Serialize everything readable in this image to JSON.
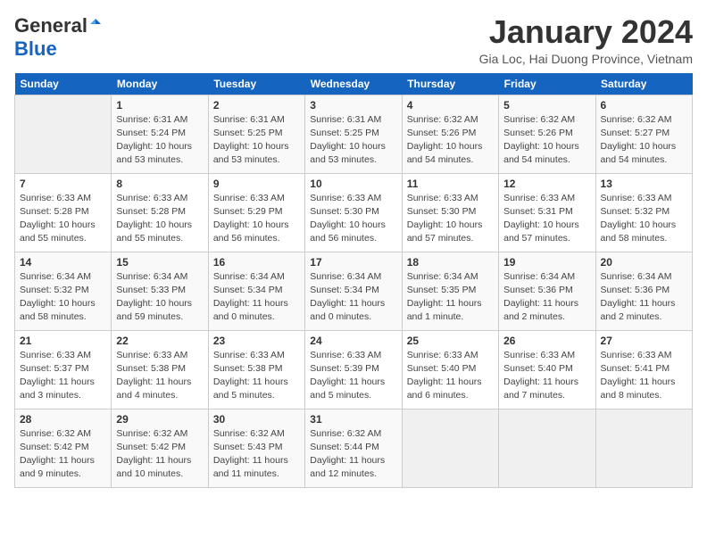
{
  "header": {
    "logo_general": "General",
    "logo_blue": "Blue",
    "month_title": "January 2024",
    "location": "Gia Loc, Hai Duong Province, Vietnam"
  },
  "days_of_week": [
    "Sunday",
    "Monday",
    "Tuesday",
    "Wednesday",
    "Thursday",
    "Friday",
    "Saturday"
  ],
  "weeks": [
    [
      {
        "day": "",
        "info": ""
      },
      {
        "day": "1",
        "info": "Sunrise: 6:31 AM\nSunset: 5:24 PM\nDaylight: 10 hours\nand 53 minutes."
      },
      {
        "day": "2",
        "info": "Sunrise: 6:31 AM\nSunset: 5:25 PM\nDaylight: 10 hours\nand 53 minutes."
      },
      {
        "day": "3",
        "info": "Sunrise: 6:31 AM\nSunset: 5:25 PM\nDaylight: 10 hours\nand 53 minutes."
      },
      {
        "day": "4",
        "info": "Sunrise: 6:32 AM\nSunset: 5:26 PM\nDaylight: 10 hours\nand 54 minutes."
      },
      {
        "day": "5",
        "info": "Sunrise: 6:32 AM\nSunset: 5:26 PM\nDaylight: 10 hours\nand 54 minutes."
      },
      {
        "day": "6",
        "info": "Sunrise: 6:32 AM\nSunset: 5:27 PM\nDaylight: 10 hours\nand 54 minutes."
      }
    ],
    [
      {
        "day": "7",
        "info": "Sunrise: 6:33 AM\nSunset: 5:28 PM\nDaylight: 10 hours\nand 55 minutes."
      },
      {
        "day": "8",
        "info": "Sunrise: 6:33 AM\nSunset: 5:28 PM\nDaylight: 10 hours\nand 55 minutes."
      },
      {
        "day": "9",
        "info": "Sunrise: 6:33 AM\nSunset: 5:29 PM\nDaylight: 10 hours\nand 56 minutes."
      },
      {
        "day": "10",
        "info": "Sunrise: 6:33 AM\nSunset: 5:30 PM\nDaylight: 10 hours\nand 56 minutes."
      },
      {
        "day": "11",
        "info": "Sunrise: 6:33 AM\nSunset: 5:30 PM\nDaylight: 10 hours\nand 57 minutes."
      },
      {
        "day": "12",
        "info": "Sunrise: 6:33 AM\nSunset: 5:31 PM\nDaylight: 10 hours\nand 57 minutes."
      },
      {
        "day": "13",
        "info": "Sunrise: 6:33 AM\nSunset: 5:32 PM\nDaylight: 10 hours\nand 58 minutes."
      }
    ],
    [
      {
        "day": "14",
        "info": "Sunrise: 6:34 AM\nSunset: 5:32 PM\nDaylight: 10 hours\nand 58 minutes."
      },
      {
        "day": "15",
        "info": "Sunrise: 6:34 AM\nSunset: 5:33 PM\nDaylight: 10 hours\nand 59 minutes."
      },
      {
        "day": "16",
        "info": "Sunrise: 6:34 AM\nSunset: 5:34 PM\nDaylight: 11 hours\nand 0 minutes."
      },
      {
        "day": "17",
        "info": "Sunrise: 6:34 AM\nSunset: 5:34 PM\nDaylight: 11 hours\nand 0 minutes."
      },
      {
        "day": "18",
        "info": "Sunrise: 6:34 AM\nSunset: 5:35 PM\nDaylight: 11 hours\nand 1 minute."
      },
      {
        "day": "19",
        "info": "Sunrise: 6:34 AM\nSunset: 5:36 PM\nDaylight: 11 hours\nand 2 minutes."
      },
      {
        "day": "20",
        "info": "Sunrise: 6:34 AM\nSunset: 5:36 PM\nDaylight: 11 hours\nand 2 minutes."
      }
    ],
    [
      {
        "day": "21",
        "info": "Sunrise: 6:33 AM\nSunset: 5:37 PM\nDaylight: 11 hours\nand 3 minutes."
      },
      {
        "day": "22",
        "info": "Sunrise: 6:33 AM\nSunset: 5:38 PM\nDaylight: 11 hours\nand 4 minutes."
      },
      {
        "day": "23",
        "info": "Sunrise: 6:33 AM\nSunset: 5:38 PM\nDaylight: 11 hours\nand 5 minutes."
      },
      {
        "day": "24",
        "info": "Sunrise: 6:33 AM\nSunset: 5:39 PM\nDaylight: 11 hours\nand 5 minutes."
      },
      {
        "day": "25",
        "info": "Sunrise: 6:33 AM\nSunset: 5:40 PM\nDaylight: 11 hours\nand 6 minutes."
      },
      {
        "day": "26",
        "info": "Sunrise: 6:33 AM\nSunset: 5:40 PM\nDaylight: 11 hours\nand 7 minutes."
      },
      {
        "day": "27",
        "info": "Sunrise: 6:33 AM\nSunset: 5:41 PM\nDaylight: 11 hours\nand 8 minutes."
      }
    ],
    [
      {
        "day": "28",
        "info": "Sunrise: 6:32 AM\nSunset: 5:42 PM\nDaylight: 11 hours\nand 9 minutes."
      },
      {
        "day": "29",
        "info": "Sunrise: 6:32 AM\nSunset: 5:42 PM\nDaylight: 11 hours\nand 10 minutes."
      },
      {
        "day": "30",
        "info": "Sunrise: 6:32 AM\nSunset: 5:43 PM\nDaylight: 11 hours\nand 11 minutes."
      },
      {
        "day": "31",
        "info": "Sunrise: 6:32 AM\nSunset: 5:44 PM\nDaylight: 11 hours\nand 12 minutes."
      },
      {
        "day": "",
        "info": ""
      },
      {
        "day": "",
        "info": ""
      },
      {
        "day": "",
        "info": ""
      }
    ]
  ]
}
